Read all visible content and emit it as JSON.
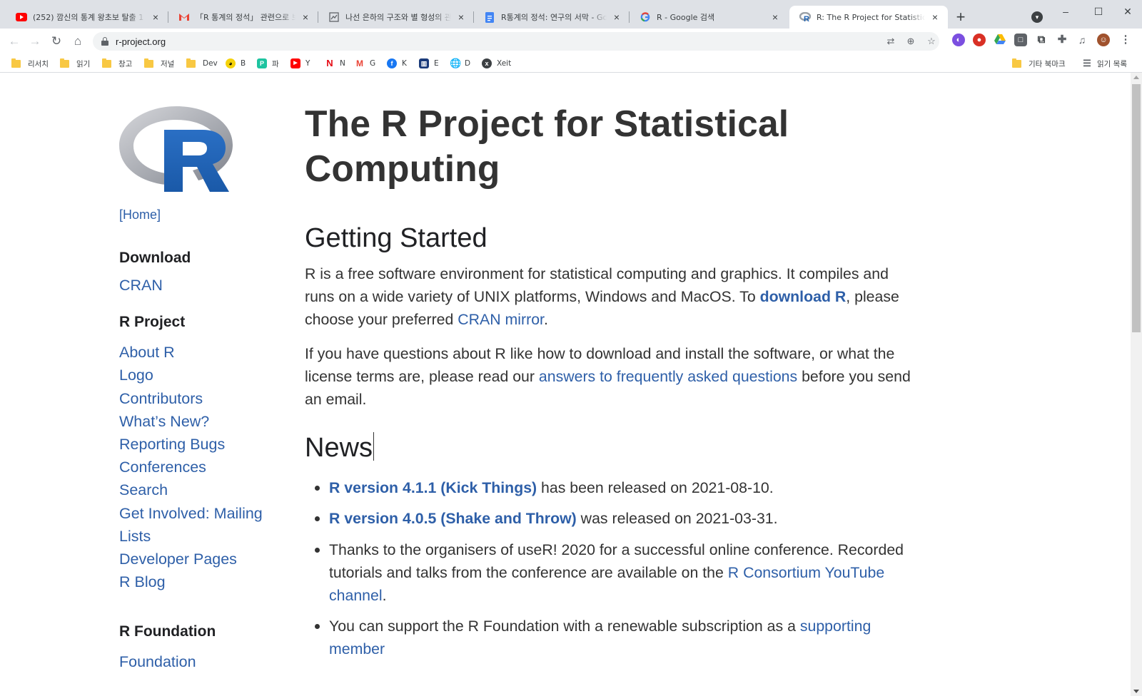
{
  "browser": {
    "tabs": [
      {
        "title": "(252) 깜신의 통계 왕초보 탈출 1",
        "favicon": "youtube-icon",
        "active": false
      },
      {
        "title": "「R 통계의 정석」 관련으로 보고드",
        "favicon": "gmail-icon",
        "active": false
      },
      {
        "title": "나선 은하의 구조와 별 형성의 관",
        "favicon": "page-icon",
        "active": false
      },
      {
        "title": "R통계의 정석: 연구의 서막 - Goo",
        "favicon": "docs-icon",
        "active": false
      },
      {
        "title": "R - Google 검색",
        "favicon": "google-icon",
        "active": false
      },
      {
        "title": "R: The R Project for Statistical Co",
        "favicon": "r-icon",
        "active": true
      }
    ],
    "new_tab": "+",
    "close_glyph": "×",
    "url": "r-project.org",
    "bookmarks": [
      {
        "label": "리서치",
        "icon": "folder-icon"
      },
      {
        "label": "읽기",
        "icon": "folder-icon"
      },
      {
        "label": "창고",
        "icon": "folder-icon"
      },
      {
        "label": "저널",
        "icon": "folder-icon"
      },
      {
        "label": "Dev",
        "icon": "folder-icon"
      },
      {
        "label": "B",
        "icon": "b-site-icon"
      },
      {
        "label": "파",
        "icon": "papago-icon"
      },
      {
        "label": "Y",
        "icon": "youtube-icon"
      },
      {
        "label": "N",
        "icon": "netflix-icon"
      },
      {
        "label": "G",
        "icon": "gmail-icon"
      },
      {
        "label": "K",
        "icon": "facebook-icon"
      },
      {
        "label": "E",
        "icon": "e-site-icon"
      },
      {
        "label": "D",
        "icon": "globe-icon"
      },
      {
        "label": "Xeit",
        "icon": "xeit-icon"
      }
    ],
    "other_bookmarks": "기타 북마크",
    "reading_list": "읽기 목록"
  },
  "sidebar": {
    "home": "[Home]",
    "sections": [
      {
        "heading": "Download",
        "links": [
          "CRAN"
        ]
      },
      {
        "heading": "R Project",
        "links": [
          "About R",
          "Logo",
          "Contributors",
          "What’s New?",
          "Reporting Bugs",
          "Conferences",
          "Search",
          "Get Involved: Mailing",
          "Lists",
          "Developer Pages",
          "R Blog"
        ]
      },
      {
        "heading": "R Foundation",
        "links": [
          "Foundation"
        ]
      }
    ]
  },
  "main": {
    "title": "The R Project for Statistical Computing",
    "getting_started": {
      "heading": "Getting Started",
      "p1": {
        "text1": "R is a free software environment for statistical computing and graphics. It compiles and runs on a wide variety of UNIX platforms, Windows and MacOS. To ",
        "link1": "download R",
        "text2": ", please choose your preferred ",
        "link2": "CRAN mirror",
        "text3": "."
      },
      "p2": {
        "text1": "If you have questions about R like how to download and install the software, or what the license terms are, please read our ",
        "link1": "answers to frequently asked questions",
        "text2": " before you send an email."
      }
    },
    "news": {
      "heading": "News",
      "items": [
        {
          "link": "R version 4.1.1 (Kick Things)",
          "text": " has been released on 2021-08-10."
        },
        {
          "link": "R version 4.0.5 (Shake and Throw)",
          "text": " was released on 2021-03-31."
        },
        {
          "text": "Thanks to the organisers of useR! 2020 for a successful online conference. Recorded tutorials and talks from the conference are available on the ",
          "link": "R Consortium YouTube channel",
          "text_after": "."
        },
        {
          "text": "You can support the R Foundation with a renewable subscription as a ",
          "link": "supporting member"
        }
      ]
    }
  },
  "colors": {
    "link": "#2e5fa8",
    "text": "#333333",
    "tabstrip": "#dee1e6",
    "logo_blue": "#1f63b4"
  }
}
